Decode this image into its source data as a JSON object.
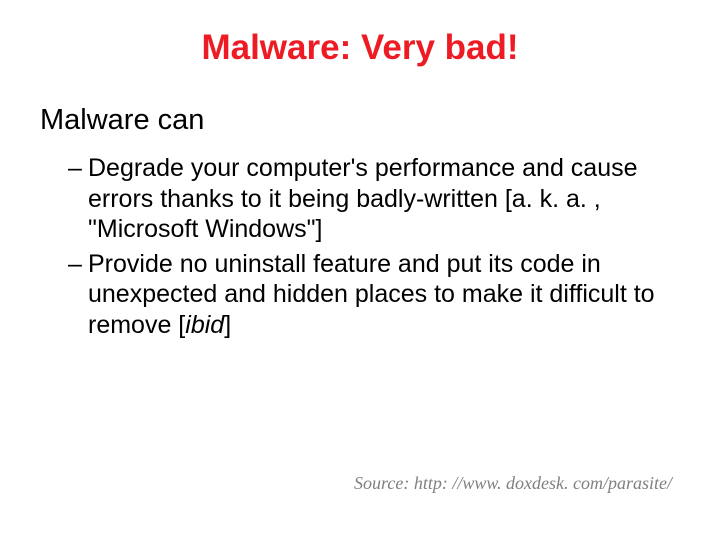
{
  "title": "Malware: Very bad!",
  "subtitle": "Malware can",
  "bullets": [
    {
      "text_before": "Degrade your computer's performance and cause errors thanks to it being badly-written [a. k. a. , \"Microsoft Windows\"]",
      "italic": "",
      "text_after": ""
    },
    {
      "text_before": "Provide no uninstall feature and put its code in unexpected and hidden places to make it difficult to remove [",
      "italic": "ibid",
      "text_after": "]"
    }
  ],
  "source": "Source: http: //www. doxdesk. com/parasite/"
}
